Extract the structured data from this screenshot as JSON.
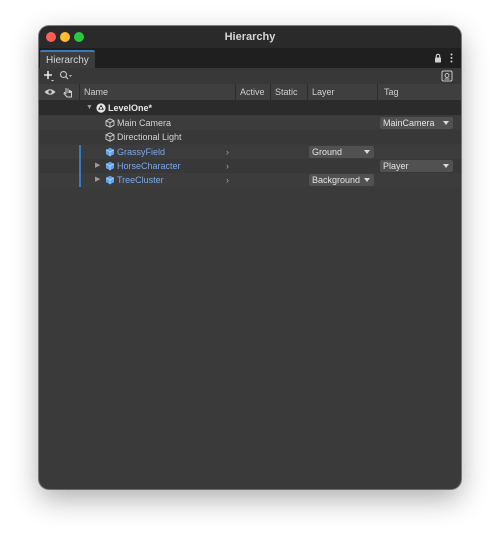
{
  "window": {
    "title": "Hierarchy"
  },
  "tab": {
    "label": "Hierarchy"
  },
  "toolbar": {
    "search_placeholder": ""
  },
  "columns": {
    "name": "Name",
    "active": "Active",
    "static": "Static",
    "layer": "Layer",
    "tag": "Tag"
  },
  "scene": {
    "name": "LevelOne*"
  },
  "items": [
    {
      "name": "Main Camera",
      "tag": "MainCamera"
    },
    {
      "name": "Directional Light"
    },
    {
      "name": "GrassyField",
      "layer": "Ground"
    },
    {
      "name": "HorseCharacter",
      "tag": "Player"
    },
    {
      "name": "TreeCluster",
      "layer": "Background"
    }
  ],
  "colors": {
    "selection_accent": "#3a79bb",
    "prefab_blue": "#7ca7e8",
    "close": "#fe5f57",
    "minimize": "#febc2e",
    "zoom": "#28c840"
  }
}
